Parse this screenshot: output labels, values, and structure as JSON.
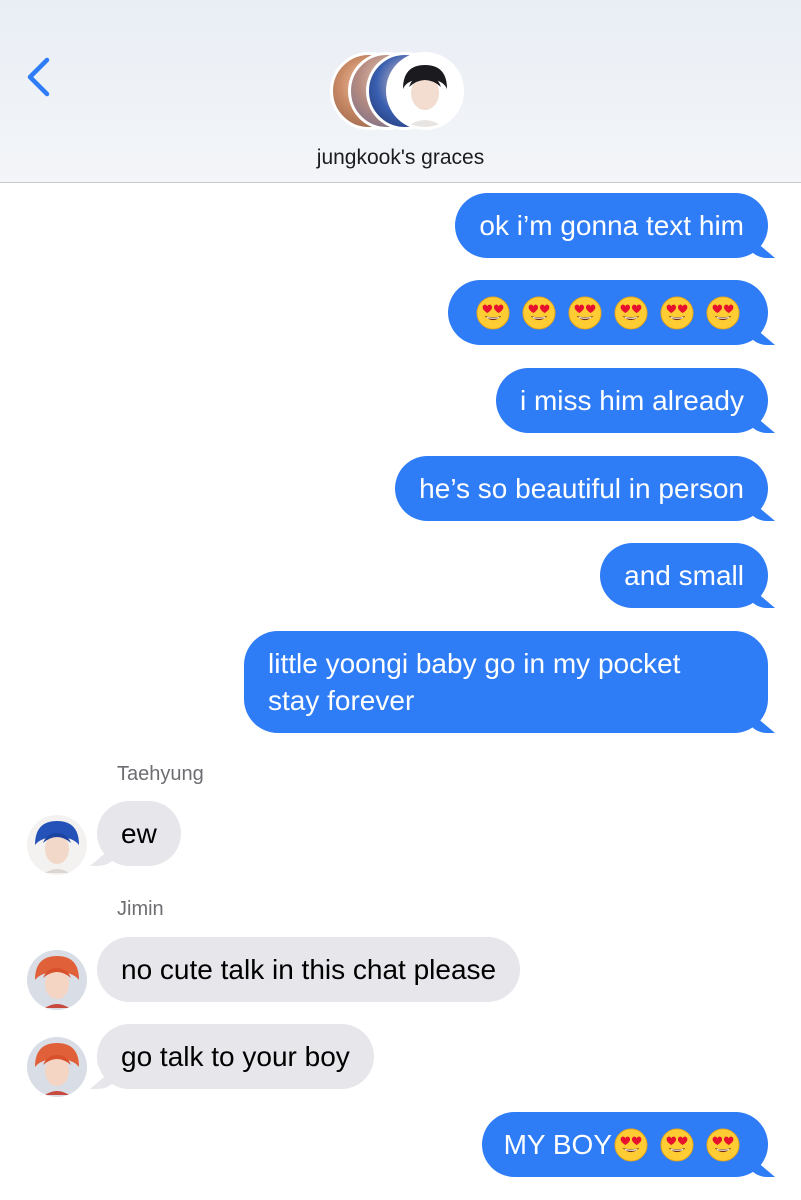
{
  "header": {
    "back_icon": "chevron-left-icon",
    "group_name": "jungkook's graces",
    "accent_color": "#2e7cf6"
  },
  "messages": [
    {
      "direction": "out",
      "text": "ok i’m gonna text him"
    },
    {
      "direction": "out",
      "emoji": [
        "heart-eyes",
        "heart-eyes",
        "heart-eyes",
        "heart-eyes",
        "heart-eyes",
        "heart-eyes"
      ]
    },
    {
      "direction": "out",
      "text": "i miss him already"
    },
    {
      "direction": "out",
      "text": "he’s so beautiful in person"
    },
    {
      "direction": "out",
      "text": "and small"
    },
    {
      "direction": "out",
      "lines": [
        "little yoongi baby go in my pocket",
        "stay forever"
      ]
    },
    {
      "direction": "in",
      "sender": "Taehyung",
      "text": "ew"
    },
    {
      "direction": "in",
      "sender": "Jimin",
      "text": "no cute talk in this chat please"
    },
    {
      "direction": "in",
      "text": "go talk to your boy"
    },
    {
      "direction": "out",
      "text": "MY BOY",
      "emoji": [
        "heart-eyes",
        "heart-eyes",
        "heart-eyes"
      ]
    }
  ],
  "colors": {
    "outgoing_bubble": "#2e7cf6",
    "incoming_bubble": "#e6e6eb"
  }
}
